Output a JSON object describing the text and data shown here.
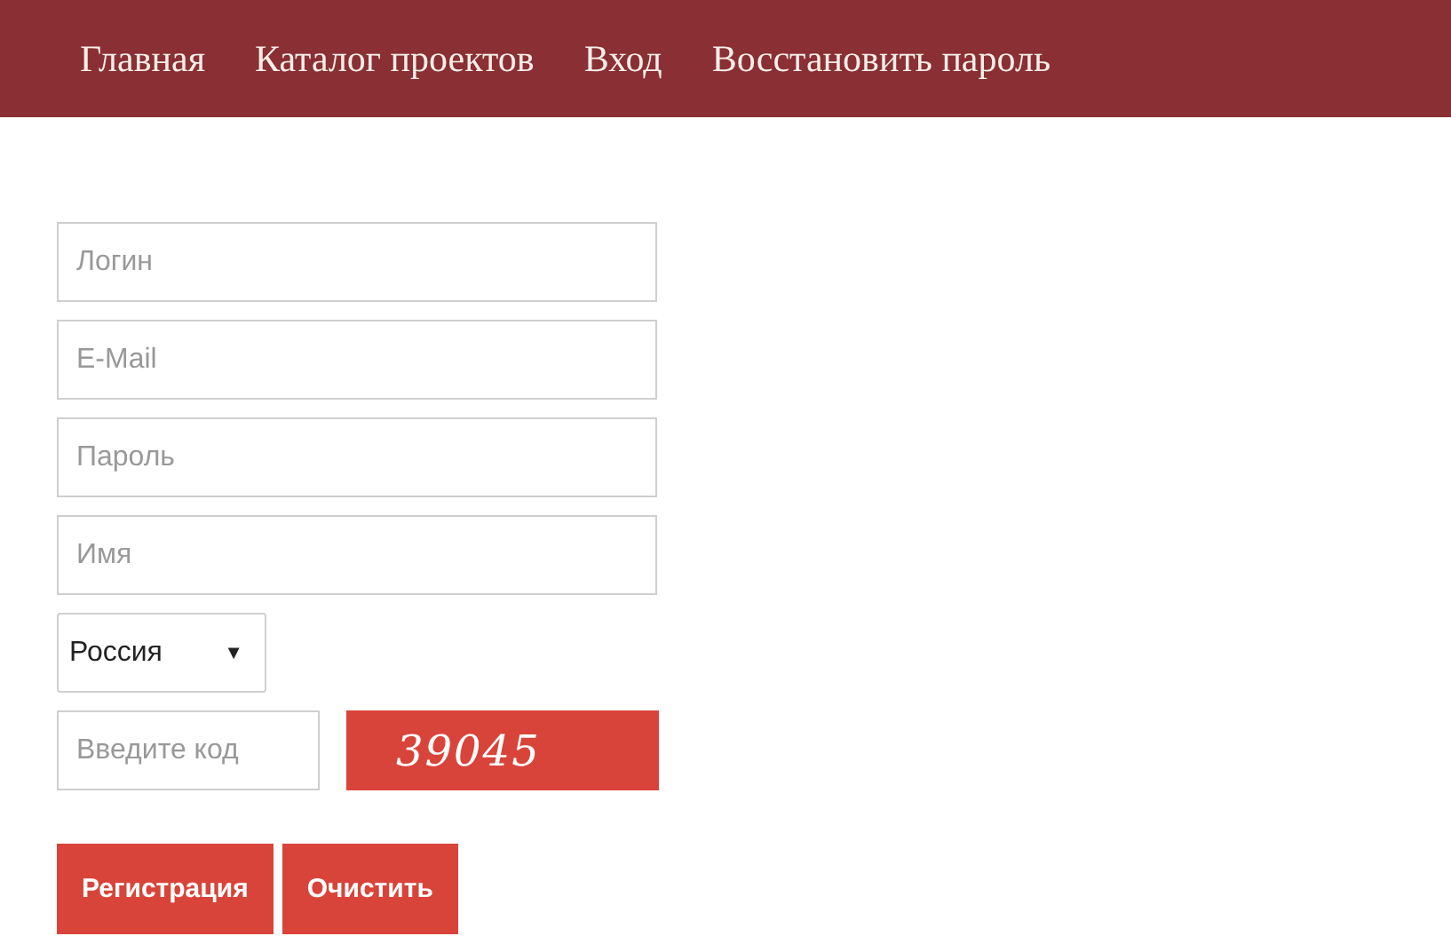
{
  "nav": {
    "items": [
      {
        "label": "Главная"
      },
      {
        "label": "Каталог проектов"
      },
      {
        "label": "Вход"
      },
      {
        "label": "Восстановить пароль"
      }
    ]
  },
  "form": {
    "fields": [
      {
        "placeholder": "Логин"
      },
      {
        "placeholder": "E-Mail"
      },
      {
        "placeholder": "Пароль"
      },
      {
        "placeholder": "Имя"
      }
    ],
    "country": {
      "value": "Россия",
      "arrow": "▼"
    },
    "captcha": {
      "placeholder": "Введите код",
      "code": "39045"
    },
    "buttons": [
      {
        "label": "Регистрация"
      },
      {
        "label": "Очистить"
      }
    ]
  }
}
